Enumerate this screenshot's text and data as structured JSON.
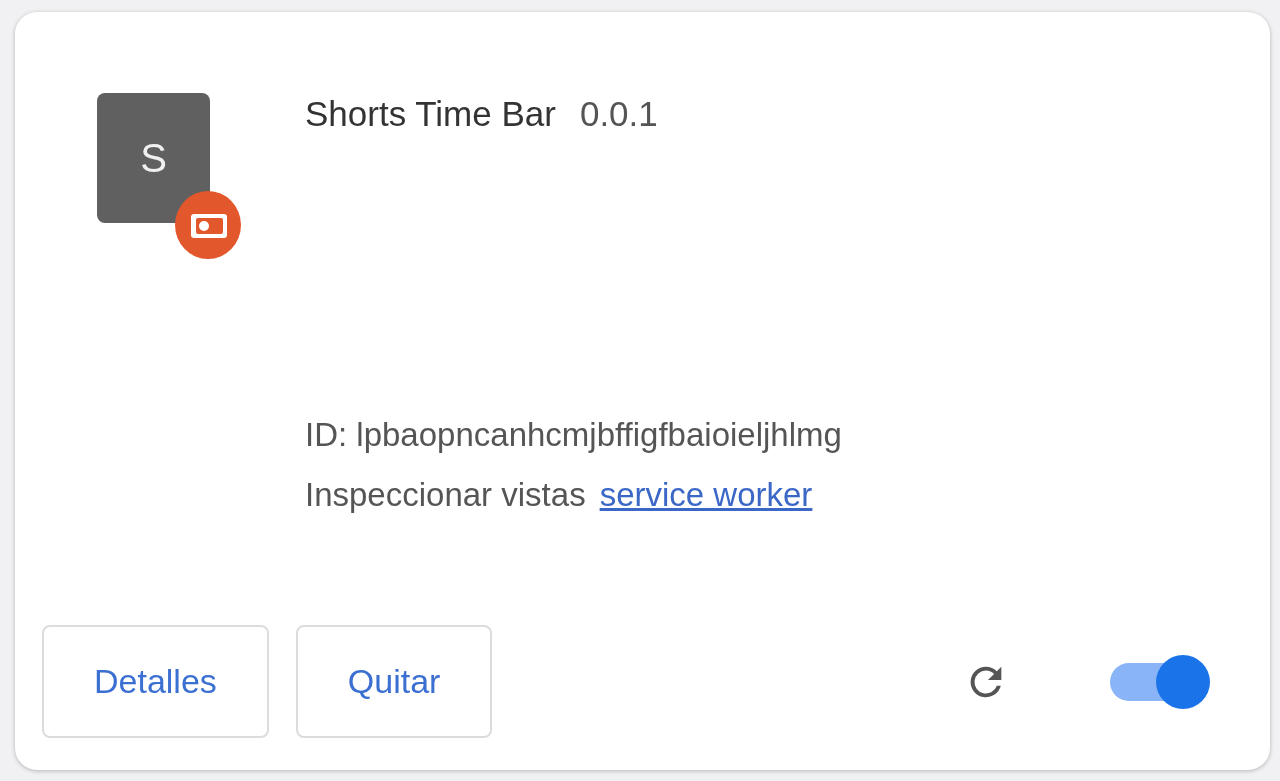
{
  "extension": {
    "icon_letter": "S",
    "name": "Shorts Time Bar",
    "version": "0.0.1",
    "id_line": "ID: lpbaopncanhcmjbffigfbaioieljhlmg",
    "inspect_label": "Inspeccionar vistas",
    "inspect_link": "service worker"
  },
  "buttons": [
    {
      "label": "Detalles"
    },
    {
      "label": "Quitar"
    }
  ],
  "enabled": {
    "on": true
  }
}
